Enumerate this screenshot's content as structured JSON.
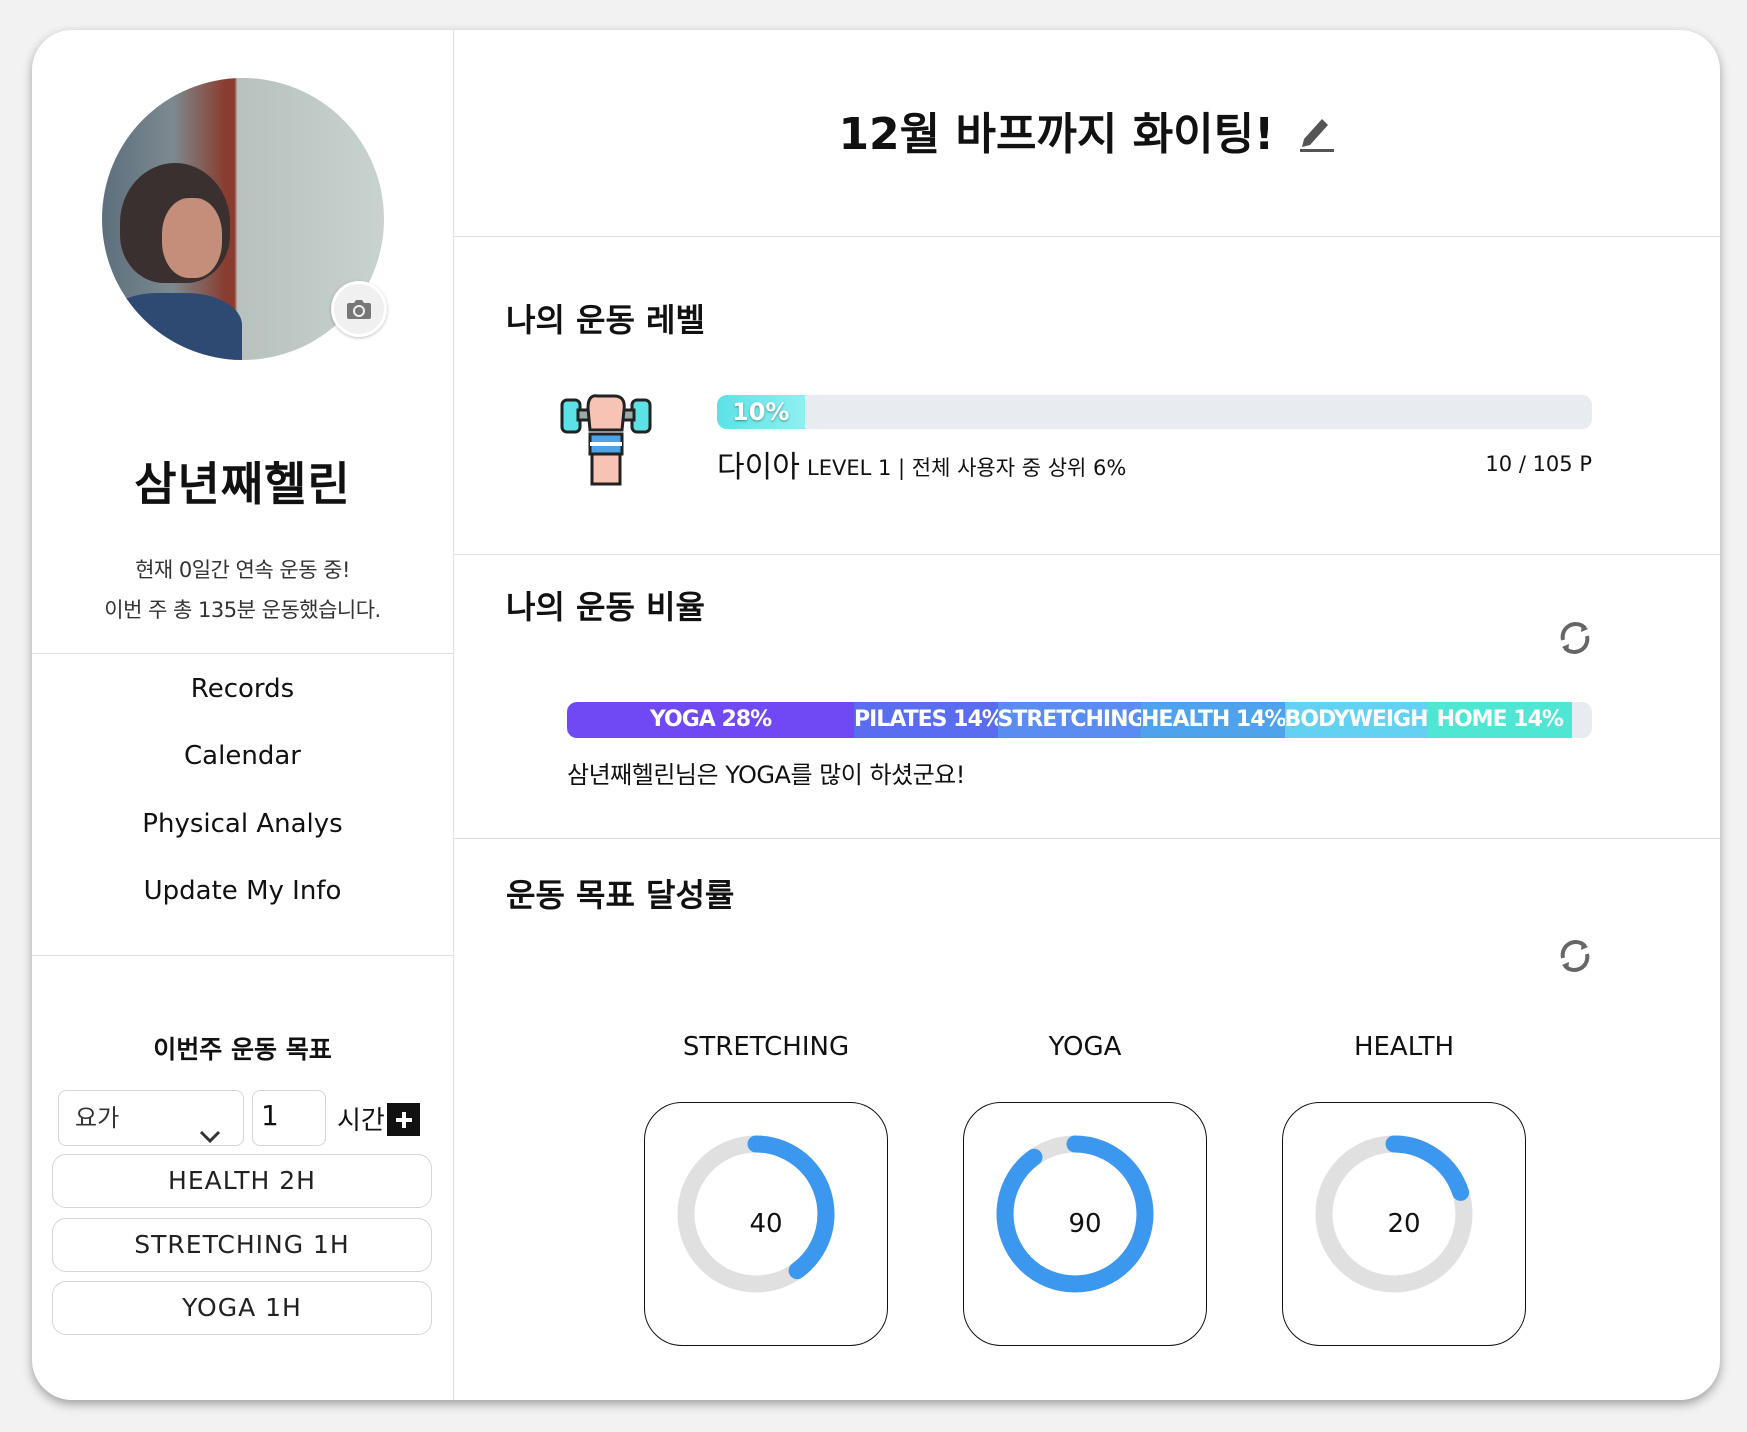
{
  "header": {
    "title": "12월 바프까지 화이팅!"
  },
  "profile": {
    "name": "삼년째헬린",
    "streak_line": "현재 0일간 연속 운동 중!",
    "weekly_line": "이번 주 총 135분 운동했습니다."
  },
  "nav": {
    "items": [
      {
        "label": "Records"
      },
      {
        "label": "Calendar"
      },
      {
        "label": "Physical Analys"
      },
      {
        "label": "Update My Info"
      }
    ]
  },
  "weekly_goal": {
    "title": "이번주 운동 목표",
    "select_value": "요가",
    "hours_value": "1",
    "unit": "시간",
    "items": [
      "HEALTH 2H",
      "STRETCHING 1H",
      "YOGA 1H"
    ]
  },
  "level": {
    "title": "나의 운동 레벨",
    "progress_label": "10%",
    "progress": 0.1,
    "tier": "다이아",
    "detail": "LEVEL 1 |  전체 사용자 중 상위 6%",
    "points": "10 / 105 P"
  },
  "ratio": {
    "title": "나의 운동 비율",
    "segments": [
      {
        "label": "YOGA 28%",
        "percent": 28,
        "color": "#7048f4"
      },
      {
        "label": "PILATES 14%",
        "percent": 14,
        "color": "#5a6cf0"
      },
      {
        "label": "STRETCHING",
        "percent": 14,
        "color": "#5b8cf2"
      },
      {
        "label": "HEALTH 14%",
        "percent": 14,
        "color": "#4fa2ec"
      },
      {
        "label": "BODYWEIGHT",
        "percent": 14,
        "color": "#63d1f2"
      },
      {
        "label": "HOME 14%",
        "percent": 14,
        "color": "#4fe6d4"
      }
    ],
    "message": "삼년째헬린님은 YOGA를 많이 하셨군요!"
  },
  "achievement": {
    "title": "운동 목표 달성률",
    "items": [
      {
        "label": "STRETCHING",
        "value": 40
      },
      {
        "label": "YOGA",
        "value": 90
      },
      {
        "label": "HEALTH",
        "value": 20
      }
    ],
    "ring_color": "#3c97ee",
    "track_color": "#e0e0e0"
  }
}
